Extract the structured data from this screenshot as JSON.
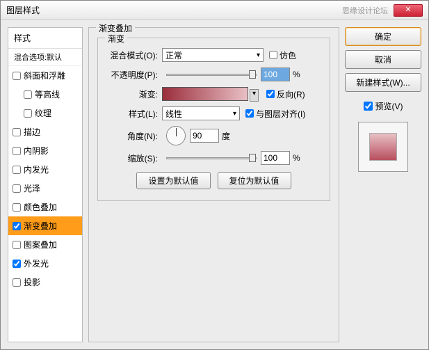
{
  "window": {
    "title": "图层样式",
    "watermark": "思缘设计论坛",
    "close": "✕"
  },
  "styles": {
    "heading": "样式",
    "sub": "混合选项:默认",
    "items": [
      {
        "label": "斜面和浮雕",
        "checked": false,
        "child": false
      },
      {
        "label": "等高线",
        "checked": false,
        "child": true
      },
      {
        "label": "纹理",
        "checked": false,
        "child": true
      },
      {
        "label": "描边",
        "checked": false,
        "child": false
      },
      {
        "label": "内阴影",
        "checked": false,
        "child": false
      },
      {
        "label": "内发光",
        "checked": false,
        "child": false
      },
      {
        "label": "光泽",
        "checked": false,
        "child": false
      },
      {
        "label": "颜色叠加",
        "checked": false,
        "child": false
      },
      {
        "label": "渐变叠加",
        "checked": true,
        "child": false,
        "selected": true
      },
      {
        "label": "图案叠加",
        "checked": false,
        "child": false
      },
      {
        "label": "外发光",
        "checked": true,
        "child": false
      },
      {
        "label": "投影",
        "checked": false,
        "child": false
      }
    ]
  },
  "panel": {
    "title": "渐变叠加",
    "group": "渐变",
    "blend_label": "混合模式(O):",
    "blend_value": "正常",
    "dither": "仿色",
    "opacity_label": "不透明度(P):",
    "opacity_value": "100",
    "opacity_unit": "%",
    "gradient_label": "渐变:",
    "reverse": "反向(R)",
    "style_label": "样式(L):",
    "style_value": "线性",
    "align": "与图层对齐(I)",
    "angle_label": "角度(N):",
    "angle_value": "90",
    "angle_unit": "度",
    "scale_label": "缩放(S):",
    "scale_value": "100",
    "scale_unit": "%",
    "reset_default": "设置为默认值",
    "restore_default": "复位为默认值"
  },
  "buttons": {
    "ok": "确定",
    "cancel": "取消",
    "new_style": "新建样式(W)...",
    "preview": "预览(V)"
  }
}
